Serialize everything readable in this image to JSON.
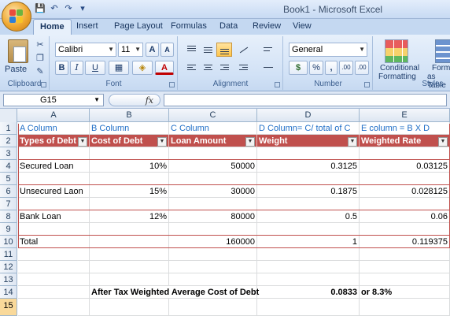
{
  "window": {
    "title": "Book1 - Microsoft Excel"
  },
  "qat": {
    "save_icon": "💾",
    "undo_icon": "↶",
    "redo_icon": "↷",
    "customize_icon": "▾"
  },
  "tabs": [
    "Home",
    "Insert",
    "Page Layout",
    "Formulas",
    "Data",
    "Review",
    "View"
  ],
  "ribbon": {
    "clipboard": {
      "label": "Clipboard",
      "paste": "Paste"
    },
    "font": {
      "label": "Font",
      "family": "Calibri",
      "size": "11",
      "grow": "A",
      "shrink": "A",
      "bold": "B",
      "italic": "I",
      "underline": "U",
      "font_color_letter": "A"
    },
    "alignment": {
      "label": "Alignment"
    },
    "number": {
      "label": "Number",
      "format": "General",
      "currency": "$",
      "percent": "%",
      "comma": ",",
      "inc_dec": ".00",
      "dec_dec": ".00"
    },
    "styles": {
      "label": "Styles",
      "conditional": "Conditional",
      "conditional2": "Formatting",
      "format_as": "Forma",
      "format_as2": "as Table"
    }
  },
  "formula_bar": {
    "cell_ref": "G15",
    "fx": "fx",
    "value": ""
  },
  "columns": [
    "A",
    "B",
    "C",
    "D",
    "E"
  ],
  "rows": [
    "1",
    "2",
    "3",
    "4",
    "5",
    "6",
    "7",
    "8",
    "9",
    "10",
    "11",
    "12",
    "13",
    "14",
    "15"
  ],
  "sheet": {
    "r1": {
      "a": "A Column",
      "b": "B Column",
      "c": "C Column",
      "d": "D Column= C/ total of C",
      "e": "E column = B X D"
    },
    "r2": {
      "a": "Types of Debt",
      "b": "Cost of Debt",
      "c": "Loan Amount",
      "d": "Weight",
      "e": "Weighted Rate"
    },
    "r4": {
      "a": "Secured Loan",
      "b": "10%",
      "c": "50000",
      "d": "0.3125",
      "e": "0.03125"
    },
    "r6": {
      "a": "Unsecured Laon",
      "b": "15%",
      "c": "30000",
      "d": "0.1875",
      "e": "0.028125"
    },
    "r8": {
      "a": "Bank Loan",
      "b": "12%",
      "c": "80000",
      "d": "0.5",
      "e": "0.06"
    },
    "r10": {
      "a": "Total",
      "c": "160000",
      "d": "1",
      "e": "0.119375"
    },
    "r14": {
      "b": "After Tax Weighted Average Cost of Debt",
      "d": "0.0833",
      "e": "or 8.3%"
    }
  },
  "colors": {
    "header_fill": "#c0504d",
    "label_blue": "#1f6ec7",
    "selected_row": "#f9d99a"
  }
}
